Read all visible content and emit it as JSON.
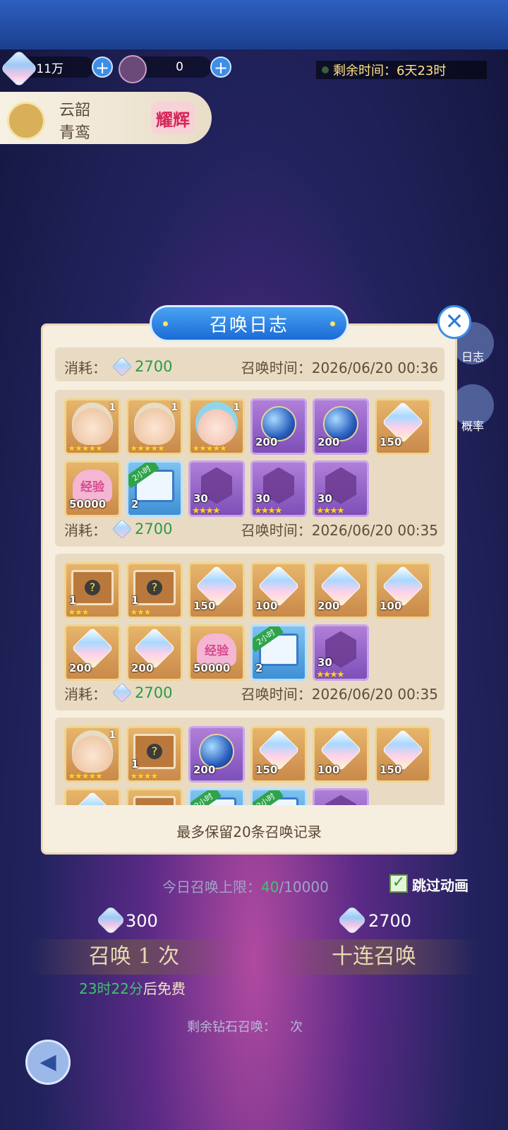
{
  "resources": {
    "diamonds": "11万",
    "tickets": "0",
    "timer_label": "剩余时间：",
    "timer_value": "6天23时"
  },
  "hero": {
    "line1": "云韶",
    "line2": "青鸾",
    "badge": "耀辉"
  },
  "side": {
    "log": "日志",
    "rate": "概率"
  },
  "dialog": {
    "title": "召唤日志",
    "close": "✕",
    "cost_label": "消耗：",
    "time_label": "召唤时间：",
    "note": "最多保留20条召唤记录",
    "records": [
      {
        "cost": "2700",
        "time": "2026/06/20 00:36"
      },
      {
        "cost": "2700",
        "time": "2026/06/20 00:35",
        "items": [
          {
            "art": "face",
            "frame": "gold",
            "lvl": "1",
            "stars": "★★★★★"
          },
          {
            "art": "face",
            "frame": "gold",
            "lvl": "1",
            "stars": "★★★★★"
          },
          {
            "art": "face2",
            "frame": "gold",
            "lvl": "1",
            "stars": "★★★★★"
          },
          {
            "art": "orb",
            "frame": "purple",
            "count": "200"
          },
          {
            "art": "orb",
            "frame": "purple",
            "count": "200"
          },
          {
            "art": "crystal",
            "frame": "gold",
            "count": "150"
          },
          {
            "art": "heart",
            "frame": "gold",
            "count": "50000",
            "text": "经验"
          },
          {
            "art": "chest",
            "frame": "blue",
            "count": "2",
            "tag": "2小时"
          },
          {
            "art": "shard",
            "frame": "purple",
            "count": "30",
            "stars": "★★★★"
          },
          {
            "art": "shard",
            "frame": "purple",
            "count": "30",
            "stars": "★★★★"
          },
          {
            "art": "shard",
            "frame": "purple",
            "count": "30",
            "stars": "★★★★"
          }
        ]
      },
      {
        "cost": "2700",
        "time": "2026/06/20 00:35",
        "items": [
          {
            "art": "box",
            "frame": "gold",
            "count": "1",
            "stars": "★★★"
          },
          {
            "art": "box",
            "frame": "gold",
            "count": "1",
            "stars": "★★★"
          },
          {
            "art": "crystal",
            "frame": "gold",
            "count": "150"
          },
          {
            "art": "crystal",
            "frame": "gold",
            "count": "100"
          },
          {
            "art": "crystal",
            "frame": "gold",
            "count": "200"
          },
          {
            "art": "crystal",
            "frame": "gold",
            "count": "100"
          },
          {
            "art": "crystal",
            "frame": "gold",
            "count": "200"
          },
          {
            "art": "crystal",
            "frame": "gold",
            "count": "200"
          },
          {
            "art": "heart",
            "frame": "gold",
            "count": "50000",
            "text": "经验"
          },
          {
            "art": "chest",
            "frame": "blue",
            "count": "2",
            "tag": "2小时"
          },
          {
            "art": "shard",
            "frame": "purple",
            "count": "30",
            "stars": "★★★★"
          }
        ]
      },
      {
        "items": [
          {
            "art": "face",
            "frame": "gold",
            "lvl": "1",
            "stars": "★★★★★"
          },
          {
            "art": "box",
            "frame": "gold",
            "count": "1",
            "stars": "★★★★"
          },
          {
            "art": "orb",
            "frame": "purple",
            "count": "200"
          },
          {
            "art": "crystal",
            "frame": "gold",
            "count": "150"
          },
          {
            "art": "crystal",
            "frame": "gold",
            "count": "100"
          },
          {
            "art": "crystal",
            "frame": "gold",
            "count": "150"
          },
          {
            "art": "crystal",
            "frame": "gold"
          },
          {
            "art": "box",
            "frame": "gold"
          },
          {
            "art": "chest",
            "frame": "blue",
            "tag": "2小时"
          },
          {
            "art": "chest",
            "frame": "blue",
            "tag": "2小时"
          },
          {
            "art": "shard",
            "frame": "purple"
          }
        ]
      }
    ]
  },
  "bottom": {
    "limit_label": "今日召唤上限：",
    "limit_used": "40",
    "limit_total": "/10000",
    "check_mark": "✓",
    "skip_label": "跳过动画",
    "single_cost": "300",
    "ten_cost": "2700",
    "single_label": "召唤 1 次",
    "ten_label": "十连召唤",
    "free_time": "23时22分",
    "free_suffix": "后免费",
    "remain_label": "剩余钻石召唤：",
    "remain_suffix": "次"
  }
}
